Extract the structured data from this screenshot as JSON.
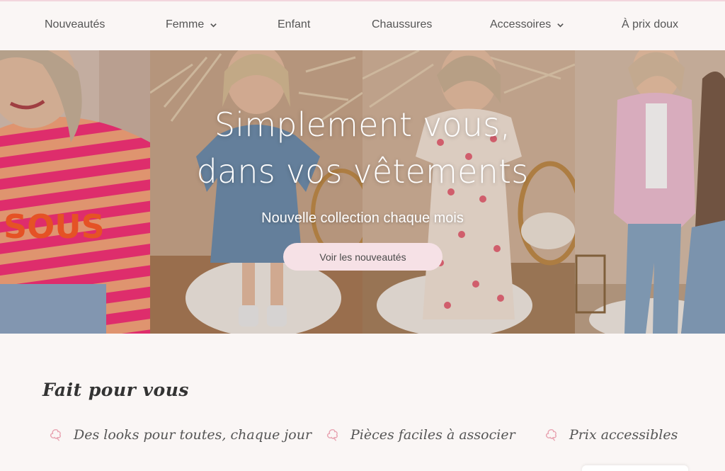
{
  "nav": {
    "items": [
      {
        "label": "Nouveautés",
        "dropdown": false
      },
      {
        "label": "Femme",
        "dropdown": true
      },
      {
        "label": "Enfant",
        "dropdown": false
      },
      {
        "label": "Chaussures",
        "dropdown": false
      },
      {
        "label": "Accessoires",
        "dropdown": true
      },
      {
        "label": "À prix doux",
        "dropdown": false
      }
    ]
  },
  "hero": {
    "title_line1": "Simplement vous,",
    "title_line2": "dans vos vêtements",
    "subtitle": "Nouvelle collection chaque mois",
    "cta_label": "Voir les nouveautés",
    "photo_text": "SOUS"
  },
  "features": {
    "title": "Fait pour vous",
    "items": [
      {
        "label": "Des looks pour toutes, chaque jour",
        "icon": "cotton-flower-icon"
      },
      {
        "label": "Pièces faciles à associer",
        "icon": "cotton-flower-icon"
      },
      {
        "label": "Prix accessibles",
        "icon": "cotton-flower-icon"
      }
    ]
  },
  "colors": {
    "background": "#faf6f5",
    "accent_pink": "#f6e1e6",
    "icon_pink": "#e8a3b1",
    "text": "#555555"
  }
}
